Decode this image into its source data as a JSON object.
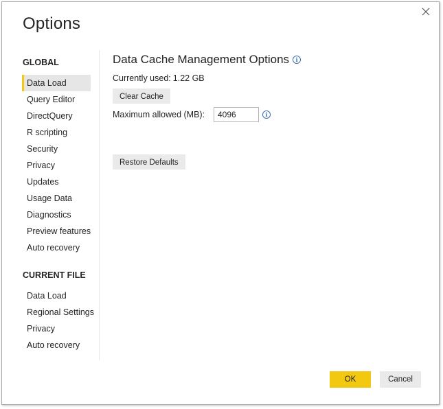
{
  "dialog": {
    "title": "Options"
  },
  "sidebar": {
    "global_header": "GLOBAL",
    "global_items": [
      {
        "label": "Data Load"
      },
      {
        "label": "Query Editor"
      },
      {
        "label": "DirectQuery"
      },
      {
        "label": "R scripting"
      },
      {
        "label": "Security"
      },
      {
        "label": "Privacy"
      },
      {
        "label": "Updates"
      },
      {
        "label": "Usage Data"
      },
      {
        "label": "Diagnostics"
      },
      {
        "label": "Preview features"
      },
      {
        "label": "Auto recovery"
      }
    ],
    "current_header": "CURRENT FILE",
    "current_items": [
      {
        "label": "Data Load"
      },
      {
        "label": "Regional Settings"
      },
      {
        "label": "Privacy"
      },
      {
        "label": "Auto recovery"
      }
    ]
  },
  "main": {
    "heading": "Data Cache Management Options",
    "currently_used_label": "Currently used:",
    "currently_used_value": "1.22 GB",
    "clear_cache_label": "Clear Cache",
    "max_allowed_label": "Maximum allowed (MB):",
    "max_allowed_value": "4096",
    "restore_defaults_label": "Restore Defaults"
  },
  "footer": {
    "ok_label": "OK",
    "cancel_label": "Cancel"
  },
  "colors": {
    "accent": "#f2c811",
    "info": "#3a6fb5",
    "button_gray": "#eaeaea",
    "selected_bg": "#e6e6e6"
  },
  "icons": {
    "close": "close-icon",
    "info": "info-icon"
  }
}
